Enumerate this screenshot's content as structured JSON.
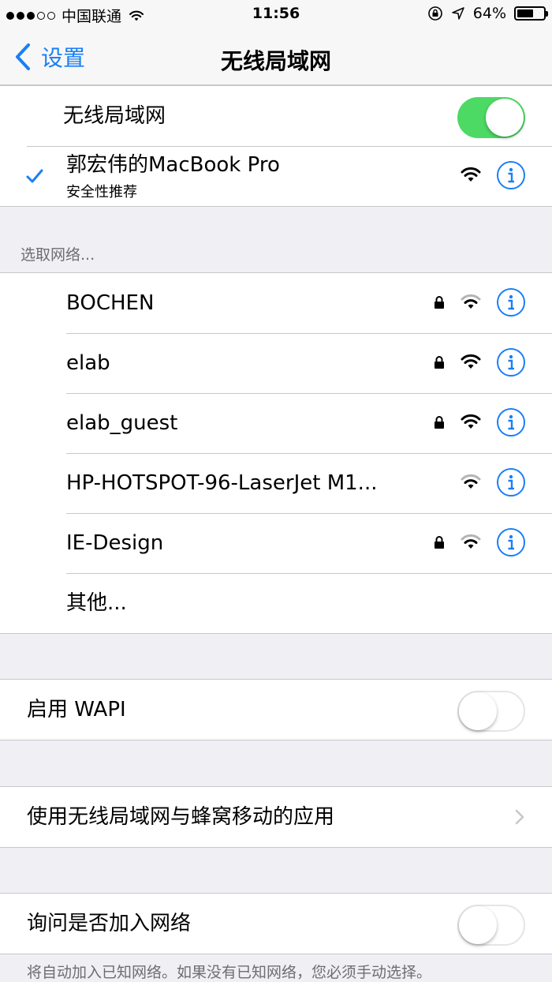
{
  "status_bar": {
    "carrier": "中国联通",
    "time": "11:56",
    "battery_percent": "64%",
    "battery_level": 0.64,
    "signal_dots_filled": 3,
    "signal_dots_total": 5
  },
  "nav": {
    "back_label": "设置",
    "title": "无线局域网"
  },
  "wifi": {
    "label": "无线局域网",
    "enabled": true
  },
  "connected": {
    "name": "郭宏伟的MacBook Pro",
    "subtitle": "安全性推荐",
    "signal": "full"
  },
  "choose_header": "选取网络...",
  "networks": [
    {
      "name": "BOCHEN",
      "locked": true,
      "signal": "weak"
    },
    {
      "name": "elab",
      "locked": true,
      "signal": "full"
    },
    {
      "name": "elab_guest",
      "locked": true,
      "signal": "full"
    },
    {
      "name": "HP-HOTSPOT-96-LaserJet M1...",
      "locked": false,
      "signal": "weak"
    },
    {
      "name": "IE-Design",
      "locked": true,
      "signal": "weak"
    }
  ],
  "other_label": "其他...",
  "wapi": {
    "label": "启用 WAPI",
    "enabled": false
  },
  "apps_row": {
    "label": "使用无线局域网与蜂窝移动的应用"
  },
  "ask_join": {
    "label": "询问是否加入网络",
    "enabled": false
  },
  "footer_note": "将自动加入已知网络。如果没有已知网络，您必须手动选择。",
  "colors": {
    "accent": "#1a7ff6",
    "toggle_on": "#4cd964",
    "background": "#efeff4"
  },
  "icons": [
    "wifi-icon",
    "lock-icon",
    "info-icon",
    "checkmark-icon",
    "chevron-right-icon",
    "back-chevron-icon",
    "location-arrow-icon",
    "rotation-lock-icon",
    "battery-icon"
  ]
}
